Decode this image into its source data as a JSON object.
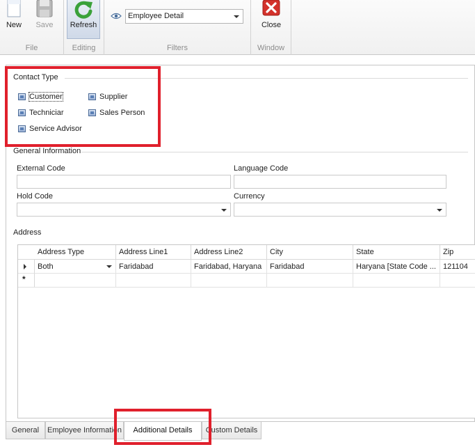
{
  "ribbon": {
    "groups": {
      "file": "File",
      "editing": "Editing",
      "filters": "Filters",
      "window": "Window"
    },
    "buttons": {
      "new": "New",
      "save": "Save",
      "refresh": "Refresh",
      "close": "Close"
    },
    "filter_view": "Employee Detail"
  },
  "contact_type": {
    "title": "Contact Type",
    "options": [
      {
        "label": "Customer"
      },
      {
        "label": "Supplier"
      },
      {
        "label": "Techniciar"
      },
      {
        "label": "Sales Person"
      },
      {
        "label": "Service Advisor"
      }
    ]
  },
  "general_info": {
    "title": "General Information",
    "external_code": {
      "label": "External Code",
      "value": ""
    },
    "language_code": {
      "label": "Language Code",
      "value": ""
    },
    "hold_code": {
      "label": "Hold Code",
      "value": ""
    },
    "currency": {
      "label": "Currency",
      "value": ""
    }
  },
  "address": {
    "title": "Address",
    "columns": [
      "Address Type",
      "Address Line1",
      "Address Line2",
      "City",
      "State",
      "Zip"
    ],
    "rows": [
      {
        "address_type": "Both",
        "line1": "Faridabad",
        "line2": "Faridabad, Haryana",
        "city": "Faridabad",
        "state": "Haryana [State Code ...",
        "zip": "121104"
      }
    ],
    "new_row_marker": "*"
  },
  "tabs": [
    "General",
    "Employee Information",
    "Additional Details",
    "Custom Details"
  ],
  "selected_tab": "Additional Details",
  "colors": {
    "highlight": "#e0202c",
    "refresh_icon": "#3aa13a",
    "close_icon": "#d3322b"
  }
}
